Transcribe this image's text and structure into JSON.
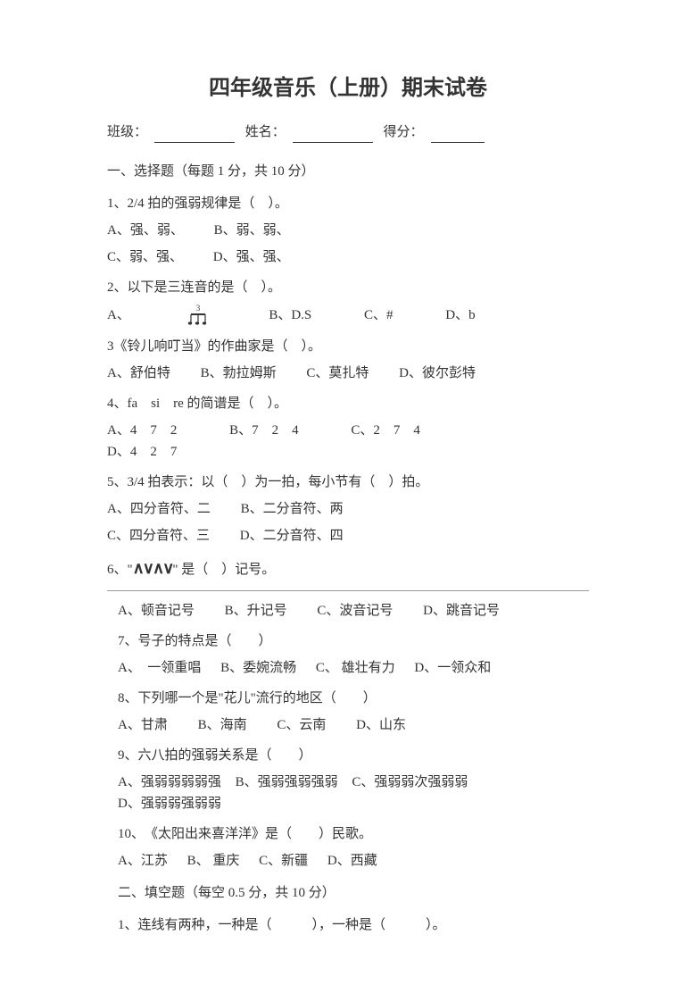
{
  "title": "四年级音乐（上册）期末试卷",
  "header": {
    "class_label": "班级：",
    "name_label": "姓名：",
    "score_label": "得分："
  },
  "section1": {
    "title": "一、选择题（每题 1 分，共 10 分）"
  },
  "q1": {
    "text": "1、2/4 拍的强弱规律是（　）。",
    "a": "A、强、弱、",
    "b": "B、弱、弱、",
    "c": "C、弱、强、",
    "d": "D、强、强、"
  },
  "q2": {
    "text": "2、以下是三连音的是（　）。",
    "a": "A、",
    "b": "B、D.S",
    "c": "C、#",
    "d": "D、b"
  },
  "q3": {
    "text": "3《铃儿响叮当》的作曲家是（　）。",
    "a": "A、舒伯特",
    "b": "B、勃拉姆斯",
    "c": "C、莫扎特",
    "d": "D、彼尔彭特"
  },
  "q4": {
    "text": "4、fa　si　re 的简谱是（　）。",
    "a": "A、4　7　2",
    "b": "B、7　2　4",
    "c": "C、2　7　4",
    "d": "D、4　2　7"
  },
  "q5": {
    "text": "5、3/4 拍表示：以（　）为一拍，每小节有（　）拍。",
    "a": "A、四分音符、二",
    "b": "B、二分音符、两",
    "c": "C、四分音符、三",
    "d": "D、二分音符、四"
  },
  "q6": {
    "text_prefix": "6、\"",
    "text_suffix": "\" 是（　）记号。",
    "a": "A、顿音记号",
    "b": "B、升记号",
    "c": "C、波音记号",
    "d": "D、跳音记号"
  },
  "q7": {
    "text": "7、号子的特点是（　　）",
    "a": "A、　一领重唱",
    "b": "B、委婉流畅",
    "c": "C、 雄壮有力",
    "d": "D、一领众和"
  },
  "q8": {
    "text": "8、下列哪一个是\"花儿\"流行的地区（　　）",
    "a": "A、甘肃",
    "b": "B、海南",
    "c": "C、云南",
    "d": "D、山东"
  },
  "q9": {
    "text": "9、六八拍的强弱关系是（　　）",
    "a": "A、强弱弱弱弱强",
    "b": "B、强弱强弱强弱",
    "c": "C、强弱弱次强弱弱",
    "d": "D、强弱弱强弱弱"
  },
  "q10": {
    "text": "10、　《太阳出来喜洋洋》是（　　）民歌。",
    "a": "A、江苏",
    "b": "B、 重庆",
    "c": "C、新疆",
    "d": "D、西藏"
  },
  "section2": {
    "title": "二、填空题（每空 0.5 分，共 10 分）"
  },
  "fill1": {
    "text": "1、连线有两种，一种是（　　　），一种是（　　　）。"
  }
}
